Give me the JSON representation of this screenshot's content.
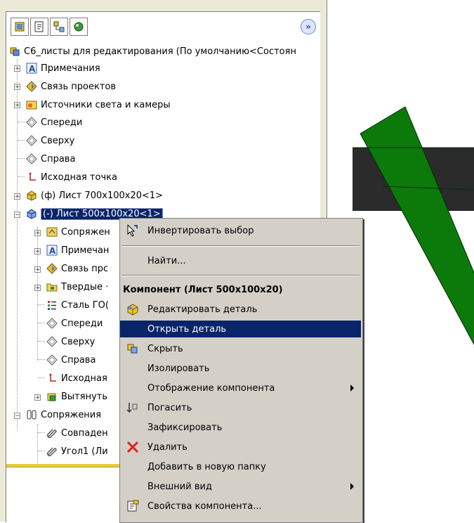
{
  "tree": {
    "root_label": "С6_листы для редактирования  (По умолчанию<Состоян",
    "items": [
      {
        "label": "Примечания",
        "icon": "annotations-icon"
      },
      {
        "label": "Связь проектов",
        "icon": "design-binder-icon"
      },
      {
        "label": "Источники света и камеры",
        "icon": "lights-cameras-icon"
      },
      {
        "label": "Спереди",
        "icon": "plane-icon"
      },
      {
        "label": "Сверху",
        "icon": "plane-icon"
      },
      {
        "label": "Справа",
        "icon": "plane-icon"
      },
      {
        "label": "Исходная точка",
        "icon": "origin-icon"
      },
      {
        "label": "(ф) Лист 700x100x20<1>",
        "icon": "part-icon"
      },
      {
        "label": "(-) Лист 500x100x20<1>",
        "icon": "part-icon"
      },
      {
        "label": "Сопряжен",
        "icon": "mates-icon"
      },
      {
        "label": "Примечан",
        "icon": "annotations-icon"
      },
      {
        "label": "Связь прс",
        "icon": "design-binder-icon"
      },
      {
        "label": "Твердые ·",
        "icon": "solid-bodies-icon"
      },
      {
        "label": "Сталь ГО(",
        "icon": "material-icon"
      },
      {
        "label": "Спереди",
        "icon": "plane-icon"
      },
      {
        "label": "Сверху",
        "icon": "plane-icon"
      },
      {
        "label": "Справа",
        "icon": "plane-icon"
      },
      {
        "label": "Исходная",
        "icon": "origin-icon"
      },
      {
        "label": "Вытянуть",
        "icon": "extrude-icon"
      },
      {
        "label": "Сопряжения",
        "icon": "mates-icon"
      },
      {
        "label": "Совпаден",
        "icon": "mate-clip-icon"
      },
      {
        "label": "Угол1 (Ли",
        "icon": "mate-clip-icon"
      }
    ]
  },
  "menu": {
    "invert_selection": "Инвертировать выбор",
    "find": "Найти...",
    "component_header": "Компонент (Лист 500x100x20)",
    "edit_part": "Редактировать деталь",
    "open_part": "Открыть деталь",
    "hide": "Скрыть",
    "isolate": "Изолировать",
    "component_display": "Отображение компонента",
    "suppress": "Погасить",
    "fix": "Зафиксировать",
    "delete": "Удалить",
    "add_to_folder": "Добавить в новую папку",
    "appearance": "Внешний вид",
    "component_properties": "Свойства компонента..."
  },
  "colors": {
    "selection": "#0a246a",
    "part_green": "#0b7a0b",
    "part_dark": "#2b2b2b"
  },
  "expand_label": "»"
}
